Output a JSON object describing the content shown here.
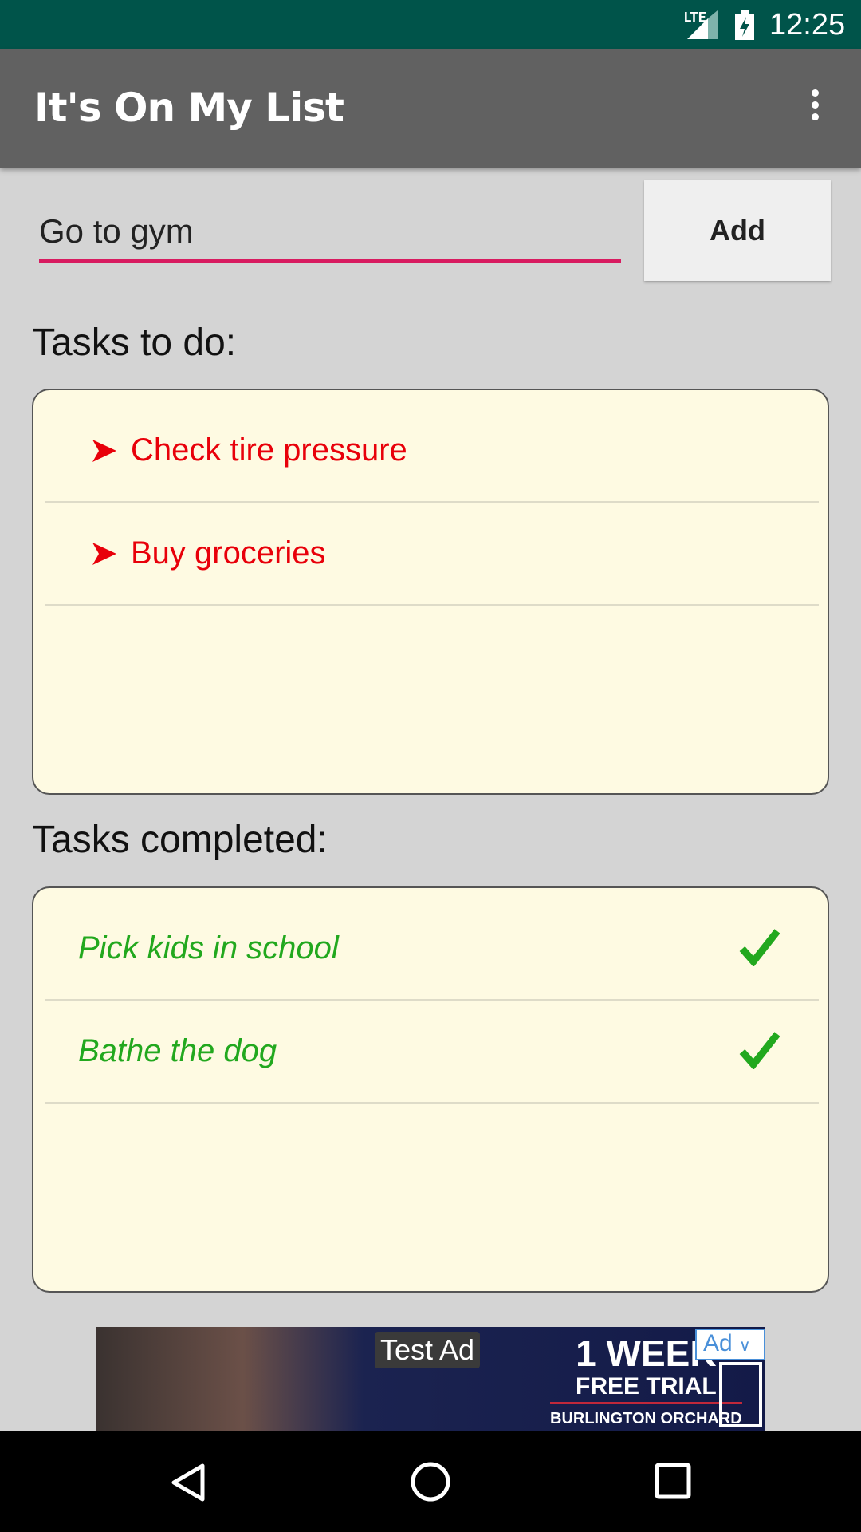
{
  "status_bar": {
    "network": "LTE",
    "time": "12:25",
    "icons": [
      "lte-signal-icon",
      "battery-charging-icon"
    ]
  },
  "toolbar": {
    "title": "It's On My List",
    "menu_icon": "more-vert-icon"
  },
  "input": {
    "value": "Go to gym",
    "add_label": "Add",
    "accent": "#d81b60"
  },
  "todo": {
    "heading": "Tasks to do:",
    "items": [
      {
        "label": "Check tire pressure"
      },
      {
        "label": "Buy groceries"
      }
    ],
    "color": "#e8000a"
  },
  "completed": {
    "heading": "Tasks completed:",
    "items": [
      {
        "label": "Pick kids in school"
      },
      {
        "label": "Bathe the dog"
      }
    ],
    "color": "#22a81e"
  },
  "ad": {
    "label": "Test Ad",
    "headline": "1 WEEK",
    "subline": "FREE TRIAL",
    "location": "BURLINGTON ORCHARD",
    "badge": "Ad"
  },
  "nav": {
    "icons": [
      "back-icon",
      "home-icon",
      "recents-icon"
    ]
  }
}
